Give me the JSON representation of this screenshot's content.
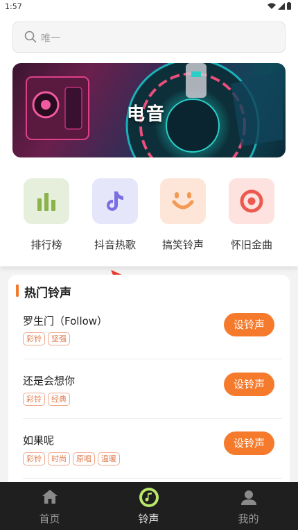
{
  "status": {
    "time": "1:57"
  },
  "search": {
    "placeholder": "唯一"
  },
  "banner": {
    "title": "电音"
  },
  "categories": [
    {
      "label": "排行榜",
      "icon": "bar-chart-icon",
      "bg": "#e6efdc",
      "color": "#8ab34a"
    },
    {
      "label": "抖音热歌",
      "icon": "tiktok-icon",
      "bg": "#e6e6fb",
      "color": "#7a6ee0"
    },
    {
      "label": "搞笑铃声",
      "icon": "smile-icon",
      "bg": "#fde6d8",
      "color": "#f39a55"
    },
    {
      "label": "怀旧金曲",
      "icon": "target-icon",
      "bg": "#fde2df",
      "color": "#ec5a4f"
    }
  ],
  "hot": {
    "title": "热门铃声",
    "button_label": "设铃声",
    "songs": [
      {
        "name": "罗生门（Follow）",
        "tags": [
          "彩铃",
          "坚强"
        ]
      },
      {
        "name": "还是会想你",
        "tags": [
          "彩铃",
          "经典"
        ]
      },
      {
        "name": "如果呢",
        "tags": [
          "彩铃",
          "时尚",
          "原唱",
          "温暖"
        ]
      }
    ]
  },
  "nav": [
    {
      "label": "首页",
      "icon": "home-icon"
    },
    {
      "label": "铃声",
      "icon": "music-note-icon"
    },
    {
      "label": "我的",
      "icon": "user-icon"
    }
  ],
  "colors": {
    "accent": "#f57a2c",
    "nav_bg": "#1f1f1f",
    "active_icon_bg": "#b9e86a"
  }
}
